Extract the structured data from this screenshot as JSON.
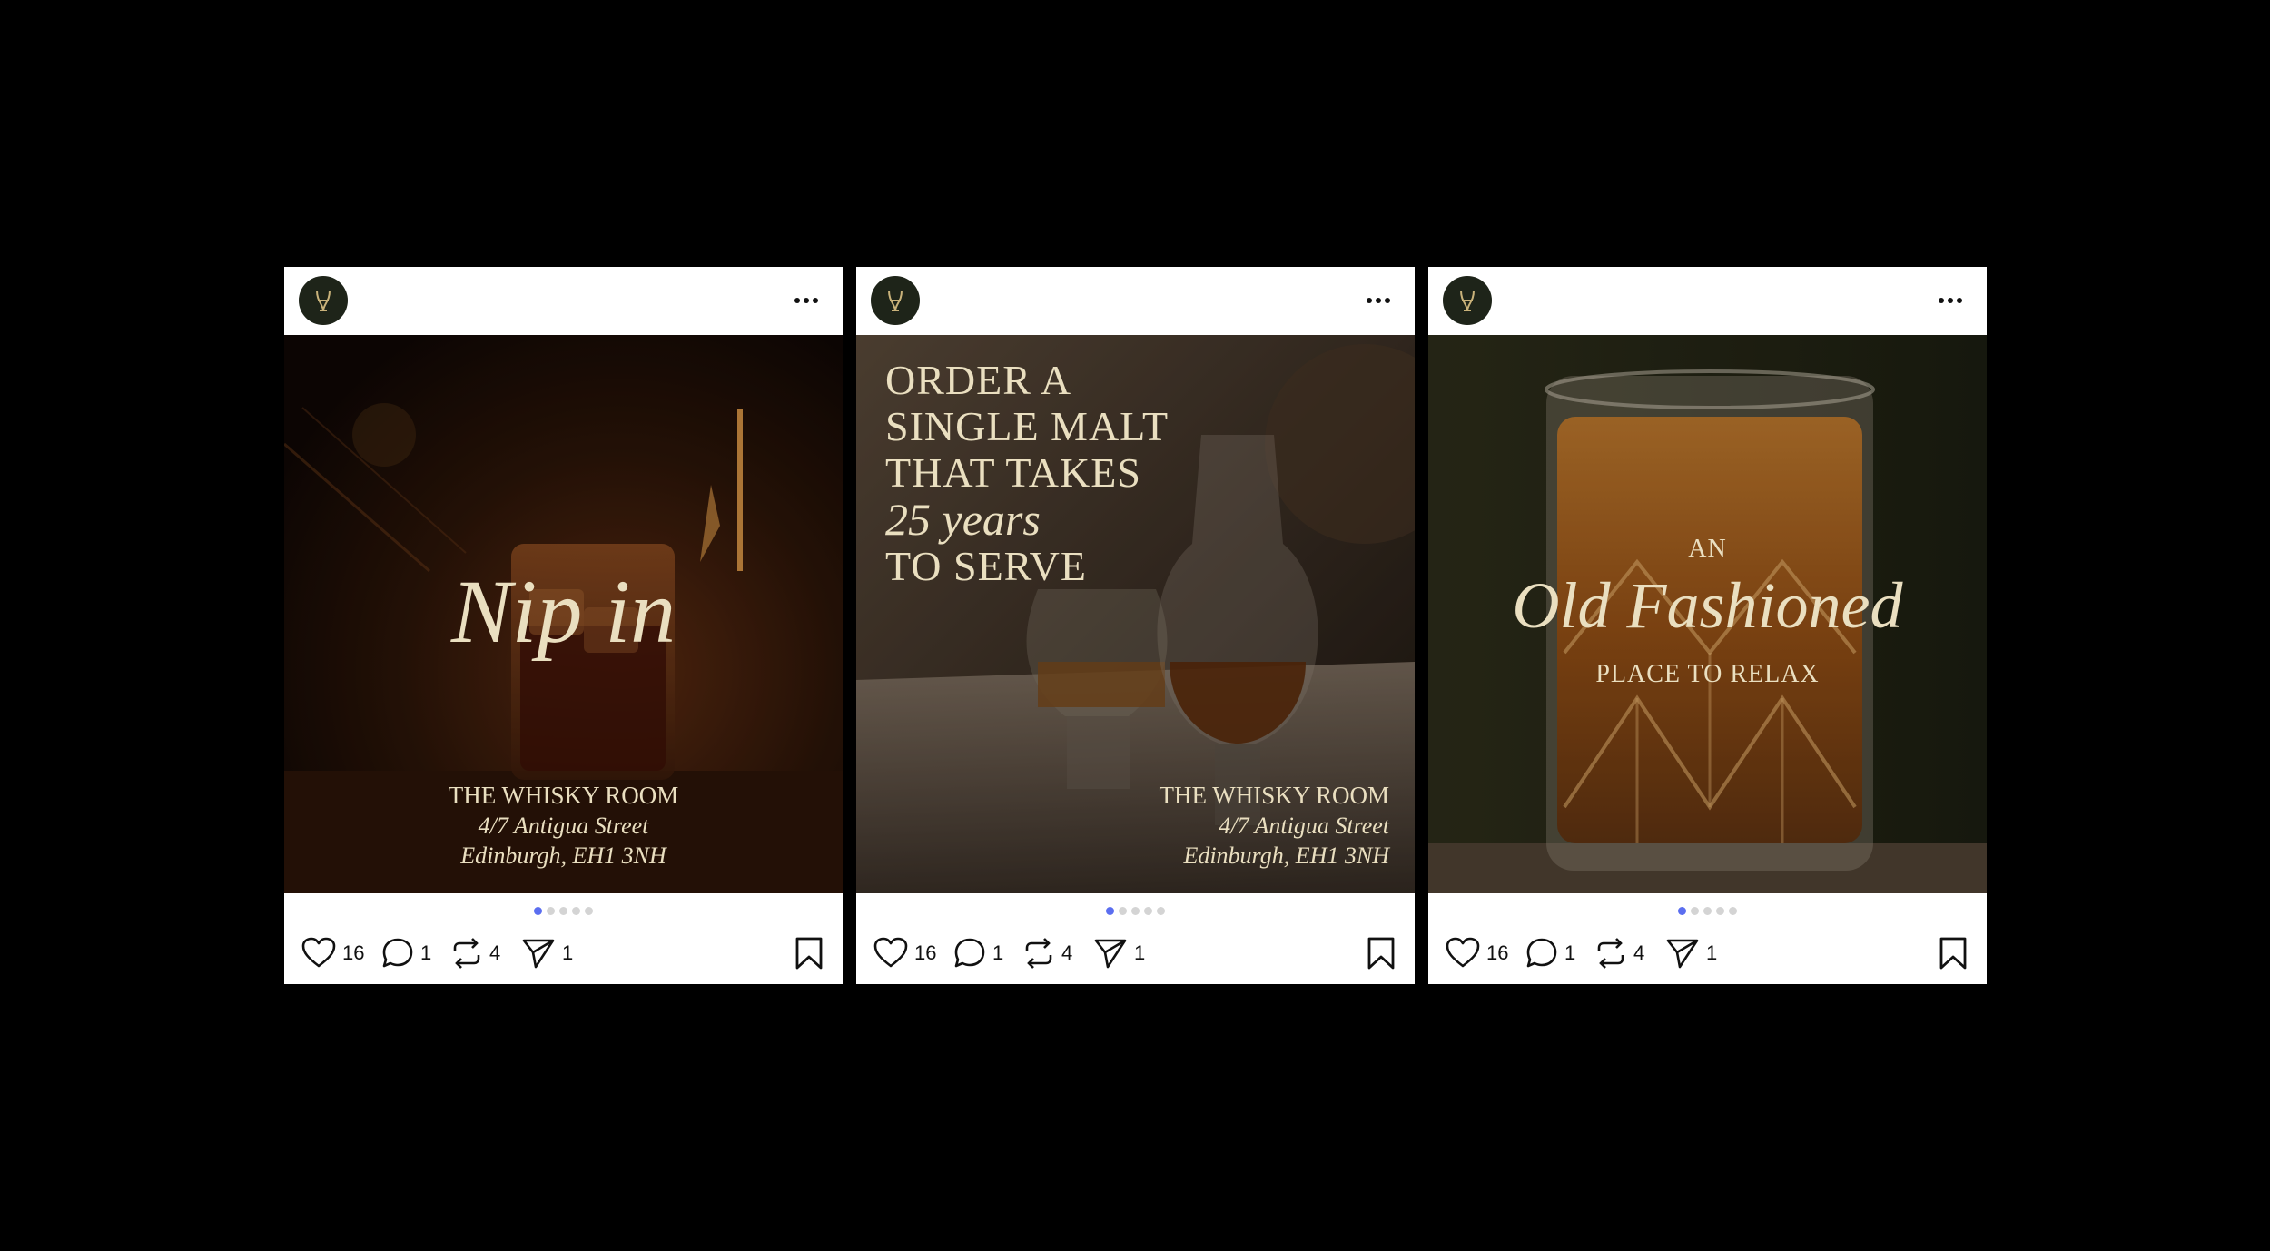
{
  "posts": [
    {
      "icons": {
        "avatar": "whisky-glass-logo-icon",
        "more": "more-options-icon"
      },
      "slide": {
        "headline": "Nip in",
        "venue": "THE WHISKY ROOM",
        "street": "4/7 Antigua Street",
        "city": "Edinburgh, EH1 3NH"
      },
      "carousel": {
        "total": 5,
        "active": 1
      },
      "stats": {
        "likes": "16",
        "comments": "1",
        "reposts": "4",
        "shares": "1"
      }
    },
    {
      "icons": {
        "avatar": "whisky-glass-logo-icon",
        "more": "more-options-icon"
      },
      "slide": {
        "line1": "ORDER A",
        "line2": "SINGLE MALT",
        "line3": "THAT TAKES",
        "line4": "25 years",
        "line5": "TO SERVE",
        "venue": "THE WHISKY ROOM",
        "street": "4/7 Antigua Street",
        "city": "Edinburgh, EH1 3NH"
      },
      "carousel": {
        "total": 5,
        "active": 1
      },
      "stats": {
        "likes": "16",
        "comments": "1",
        "reposts": "4",
        "shares": "1"
      }
    },
    {
      "icons": {
        "avatar": "whisky-glass-logo-icon",
        "more": "more-options-icon"
      },
      "slide": {
        "pre": "AN",
        "headline": "Old Fashioned",
        "post": "PLACE TO RELAX"
      },
      "carousel": {
        "total": 5,
        "active": 1
      },
      "stats": {
        "likes": "16",
        "comments": "1",
        "reposts": "4",
        "shares": "1"
      }
    }
  ],
  "colors": {
    "overlay_text": "#eadfc0",
    "avatar_bg": "#1e2419",
    "logo_gold": "#c9b27a",
    "dot_active": "#5b6ef0",
    "dot_inactive": "#d4d4d4"
  }
}
